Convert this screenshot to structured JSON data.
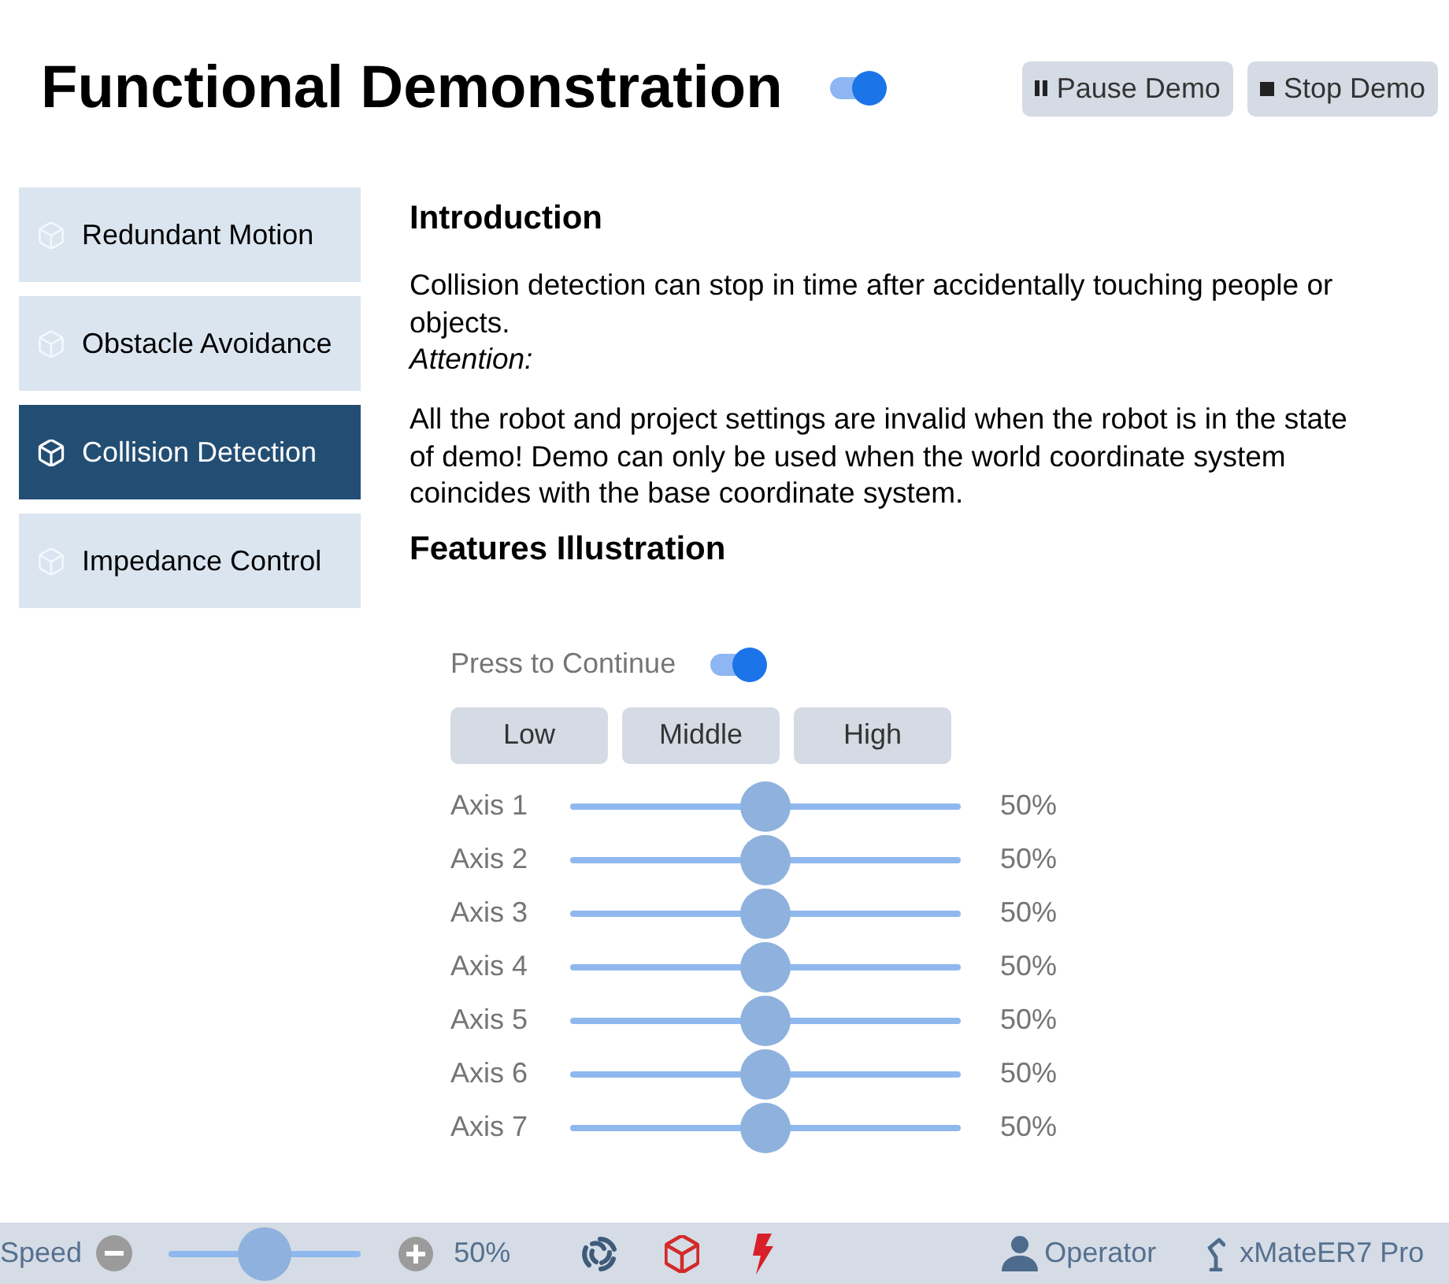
{
  "header": {
    "title": "Functional Demonstration",
    "demo_toggle": {
      "on": true
    },
    "buttons": [
      {
        "kind": "pause",
        "label": "Pause Demo"
      },
      {
        "kind": "stop",
        "label": "Stop Demo"
      }
    ]
  },
  "sidebar": {
    "items": [
      {
        "label": "Redundant Motion",
        "selected": false
      },
      {
        "label": "Obstacle Avoidance",
        "selected": false
      },
      {
        "label": "Collision Detection",
        "selected": true
      },
      {
        "label": "Impedance Control",
        "selected": false
      }
    ]
  },
  "introduction": {
    "heading": "Introduction",
    "description": "Collision detection can stop in time after accidentally touching people or objects.",
    "attention_label": "Attention:",
    "attention_text": "All the robot and project settings are invalid when the robot is in the state of demo! Demo can only be used when the world coordinate system coincides with the base coordinate system."
  },
  "features": {
    "heading": "Features Illustration",
    "press_to_continue": {
      "label": "Press to Continue",
      "on": true
    },
    "presets": [
      {
        "label": "Low"
      },
      {
        "label": "Middle"
      },
      {
        "label": "High"
      }
    ],
    "axes": [
      {
        "label": "Axis 1",
        "level": 0.5,
        "reading": "50%"
      },
      {
        "label": "Axis 2",
        "level": 0.5,
        "reading": "50%"
      },
      {
        "label": "Axis 3",
        "level": 0.5,
        "reading": "50%"
      },
      {
        "label": "Axis 4",
        "level": 0.5,
        "reading": "50%"
      },
      {
        "label": "Axis 5",
        "level": 0.5,
        "reading": "50%"
      },
      {
        "label": "Axis 6",
        "level": 0.5,
        "reading": "50%"
      },
      {
        "label": "Axis 7",
        "level": 0.5,
        "reading": "50%"
      }
    ]
  },
  "status_bar": {
    "speed": {
      "label": "Speed",
      "level": 0.5,
      "reading": "50%"
    },
    "user": "Operator",
    "robot": "xMateER7 Pro"
  }
}
